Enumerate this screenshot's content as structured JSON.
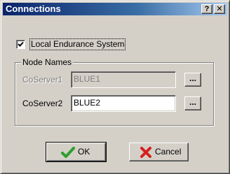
{
  "window": {
    "title": "Connections",
    "help_label": "?",
    "close_label": "✕"
  },
  "local_system": {
    "label": "Local Endurance System",
    "checked": true
  },
  "node_names": {
    "group_label": "Node Names",
    "coserver1": {
      "label": "CoServer1",
      "value": "BLUE1",
      "enabled": false
    },
    "coserver2": {
      "label": "CoServer2",
      "value": "BLUE2",
      "enabled": true
    },
    "browse_label": "..."
  },
  "buttons": {
    "ok_label": "OK",
    "cancel_label": "Cancel"
  },
  "icons": {
    "ok": "green-checkmark-icon",
    "cancel": "red-x-icon"
  },
  "colors": {
    "titlebar_start": "#0a246a",
    "titlebar_end": "#a6caf0",
    "dialog_face": "#d4d0c8",
    "ok_icon": "#2e9e2e",
    "cancel_icon": "#d42020"
  }
}
